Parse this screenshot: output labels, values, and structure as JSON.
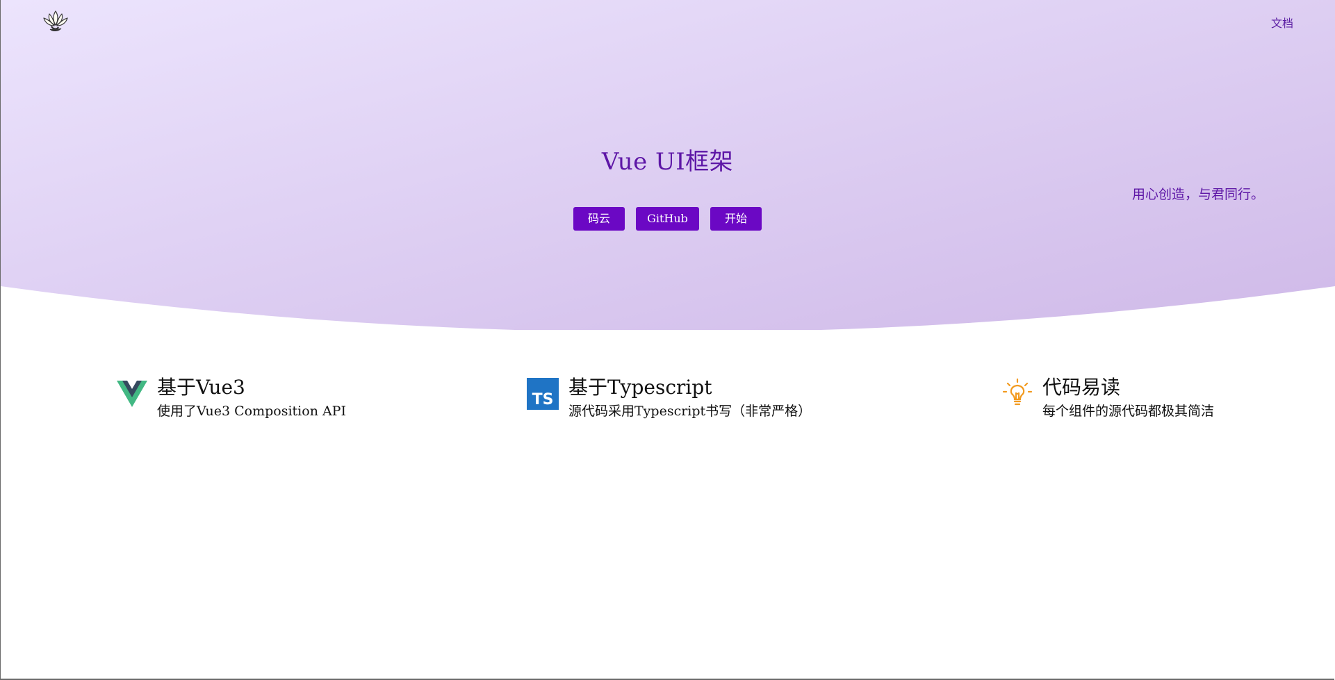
{
  "nav": {
    "logo_icon": "lotus-icon",
    "docs_label": "文档"
  },
  "hero": {
    "title": "Vue UI框架",
    "slogan": "用心创造，与君同行。",
    "buttons": [
      {
        "label": "码云"
      },
      {
        "label": "GitHub"
      },
      {
        "label": "开始"
      }
    ],
    "gradient_from": "#ece4fd",
    "gradient_to": "#d0b9e9",
    "accent": "#6b08c4",
    "text_color": "#5d16a6"
  },
  "features": [
    {
      "icon": "vue-logo-icon",
      "title": "基于Vue3",
      "desc": "使用了Vue3 Composition API"
    },
    {
      "icon": "typescript-logo-icon",
      "title": "基于Typescript",
      "desc": "源代码采用Typescript书写（非常严格）"
    },
    {
      "icon": "lightbulb-icon",
      "title": "代码易读",
      "desc": "每个组件的源代码都极其简洁"
    }
  ]
}
